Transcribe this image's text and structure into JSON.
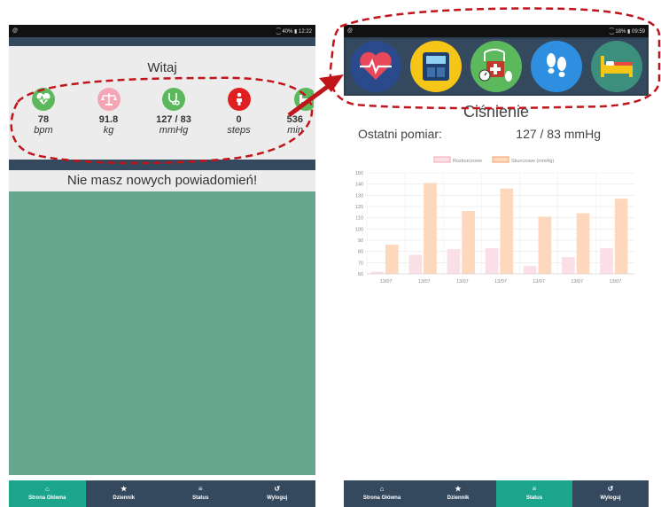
{
  "left_phone": {
    "status": {
      "left_icon": "@",
      "right": "⁐ 40% ▮ 12:22"
    },
    "welcome_title": "Witaj",
    "stats": [
      {
        "icon": "heart-rate-icon",
        "color": "#5cb85c",
        "value": "78",
        "unit": "bpm"
      },
      {
        "icon": "scale-icon",
        "color": "#f4a6b5",
        "value": "91.8",
        "unit": "kg"
      },
      {
        "icon": "stethoscope-icon",
        "color": "#5cb85c",
        "value": "127 / 83",
        "unit": "mmHg"
      },
      {
        "icon": "footsteps-icon",
        "color": "#e02020",
        "value": "0",
        "unit": "steps"
      },
      {
        "icon": "bed-icon",
        "color": "#5cb85c",
        "value": "536",
        "unit": "min"
      }
    ],
    "notification": "Nie masz nowych powiadomień!"
  },
  "nav": {
    "items": [
      {
        "label": "Strona Główna",
        "icon": "home-icon"
      },
      {
        "label": "Dziennik",
        "icon": "star-icon"
      },
      {
        "label": "Status",
        "icon": "menu-icon"
      },
      {
        "label": "Wyloguj",
        "icon": "logout-icon"
      }
    ],
    "left_active": 0,
    "right_active": 2
  },
  "right_phone": {
    "status": {
      "left_icon": "@",
      "right": "⁐ 18% ▮ 09:59"
    },
    "category_icons": [
      {
        "icon": "heart-icon",
        "color": "#2b4a8c"
      },
      {
        "icon": "scale-icon",
        "color": "#f5c518"
      },
      {
        "icon": "blood-pressure-icon",
        "color": "#5cb85c"
      },
      {
        "icon": "footsteps-icon",
        "color": "#2e8fe0"
      },
      {
        "icon": "bed-icon",
        "color": "#3b8f7c"
      }
    ],
    "section_title": "Ciśnienie",
    "last_label": "Ostatni pomiar:",
    "last_value": "127 / 83 mmHg"
  },
  "chart_data": {
    "type": "bar",
    "categories": [
      "13/07",
      "13/07",
      "13/07",
      "13/07",
      "13/07",
      "13/07",
      "13/07"
    ],
    "series": [
      {
        "name": "Rozkurczowe",
        "values": [
          62,
          77,
          82,
          83,
          67,
          75,
          83
        ],
        "color": "#fbdfe6",
        "border": "#f4a6b5"
      },
      {
        "name": "Skurczowe (mmHg)",
        "values": [
          86,
          141,
          116,
          136,
          111,
          114,
          127
        ],
        "color": "#fdd8bd",
        "border": "#f5a06a"
      }
    ],
    "ylim": [
      60,
      150
    ],
    "yticks": [
      60,
      70,
      80,
      90,
      100,
      110,
      120,
      130,
      140,
      150
    ],
    "legend": "top",
    "grid": true
  },
  "annotation_color": "#c0161b"
}
